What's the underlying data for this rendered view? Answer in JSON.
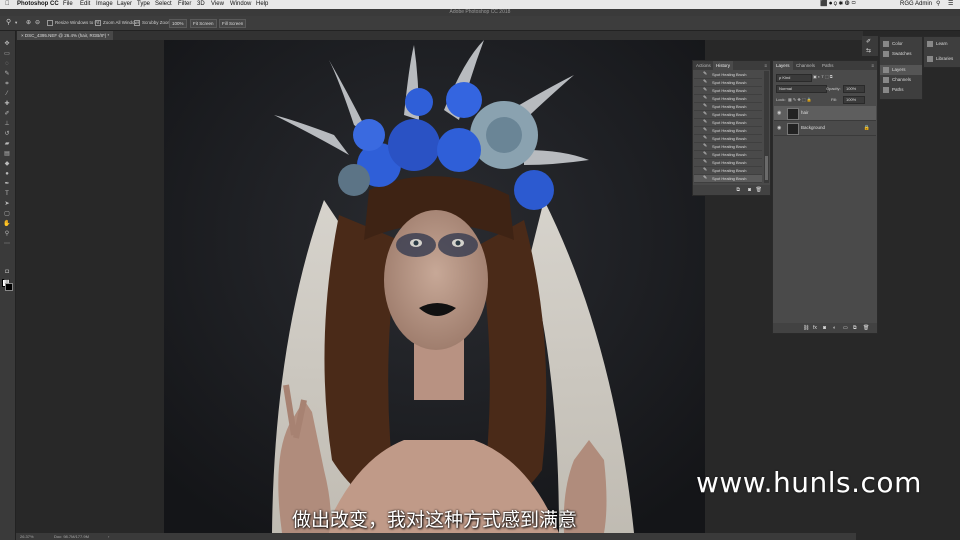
{
  "menubar": {
    "apple_icon": "apple-icon",
    "app_name": "Photoshop CC",
    "items": [
      "File",
      "Edit",
      "Image",
      "Layer",
      "Type",
      "Select",
      "Filter",
      "3D",
      "View",
      "Window",
      "Help"
    ],
    "user": "RGG Admin"
  },
  "window": {
    "title": "Adobe Photoshop CC 2018"
  },
  "options": {
    "resize_windows": "Resize Windows to Fit",
    "zoom_all": "Zoom All Windows",
    "scrubby_zoom": "Scrubby Zoom",
    "zoom_100": "100%",
    "fit_screen": "Fit Screen",
    "fill_screen": "Fill Screen"
  },
  "document": {
    "tab_label": "DSC_4395.NEF @ 26.4% (hair, RGB/8*) *",
    "zoom": "26.37%",
    "doc_size": "Doc: 98.7M/177.9M"
  },
  "history": {
    "tabs": [
      "Actions",
      "History"
    ],
    "active_tab": "History",
    "items": [
      "Spot Healing Brush",
      "Spot Healing Brush",
      "Spot Healing Brush",
      "Spot Healing Brush",
      "Spot Healing Brush",
      "Spot Healing Brush",
      "Spot Healing Brush",
      "Spot Healing Brush",
      "Spot Healing Brush",
      "Spot Healing Brush",
      "Spot Healing Brush",
      "Spot Healing Brush",
      "Spot Healing Brush",
      "Spot Healing Brush"
    ]
  },
  "layers": {
    "tabs": [
      "Layers",
      "Channels",
      "Paths"
    ],
    "kind": "ρ Kind",
    "blend_mode": "Normal",
    "opacity_label": "Opacity:",
    "opacity": "100%",
    "lock_label": "Lock:",
    "fill_label": "Fill:",
    "fill": "100%",
    "items": [
      {
        "name": "hair",
        "selected": true,
        "locked": false
      },
      {
        "name": "Background",
        "selected": false,
        "locked": true
      }
    ]
  },
  "dock": {
    "col1": [
      "Color",
      "Swatches",
      "Layers",
      "Channels",
      "Paths"
    ],
    "col2": [
      "Learn",
      "Libraries"
    ]
  },
  "subtitle": "做出改变，我对这种方式感到满意",
  "watermark": "www.hunls.com",
  "colors": {
    "accent_blue": "#2f5fd8",
    "panel_bg": "#4a4a4a"
  }
}
